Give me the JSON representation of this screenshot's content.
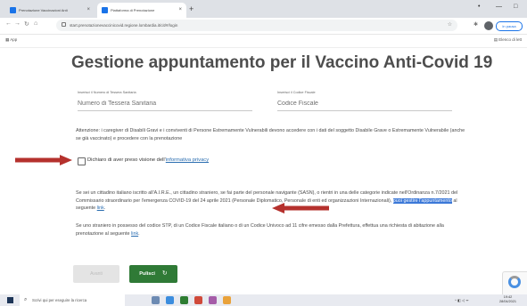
{
  "browser": {
    "tabs": [
      {
        "label": "Prenotazione Vaccinazioni Anti",
        "active": false
      },
      {
        "label": "Piattaforma di Prenotazione",
        "active": true
      }
    ],
    "new_tab": "+",
    "window_controls": [
      "•",
      "—",
      "□"
    ],
    "url": "start.prenotazionevaccinicovid.regione.lombardia.it/cit/#/login",
    "apps_label": "App",
    "other_bookmarks": "Elenco di lett",
    "profile_label": "In pausa"
  },
  "page": {
    "title": "Gestione appuntamento per il Vaccino Anti-Covid 19",
    "tessera": {
      "label": "Inserisci il Numero di Tessera Sanitaria",
      "placeholder": "Numero di Tessera Sanitaria"
    },
    "codice_fiscale": {
      "label": "Inserisci il Codice Fiscale",
      "placeholder": "Codice Fiscale"
    },
    "caregiver_notice": "Attenzione: i caregiver di Disabili Gravi e i conviventi di Persone Estremamente Vulnerabili devono accedere con i dati del soggetto Disabile Grave o Estremamente Vulnerabile (anche se già vaccinato) e procedere con la prenotazione",
    "privacy_checkbox": {
      "text": "Dichiaro di aver preso visione dell'",
      "link": "informativa privacy"
    },
    "aire_paragraph": {
      "text": "Se sei un cittadino italiano iscritto all'A.I.R.E., un cittadino straniero, se fai parte del personale navigante (SASN), o rientri in una delle categorie indicate nell'Ordinanza n.7/2021 del Commissario straordinario per l'emergenza COVID-19 del 24 aprile 2021 (Personale Diplomatico, Personale di enti ed organizzazioni Internazionali), ",
      "highlight": "puoi gestire l'appuntamento",
      "suffix": " al seguente ",
      "link": "link"
    },
    "stp_paragraph": {
      "text": "Se uno straniero in possesso del codice STP, di un Codice Fiscale italiano o di un Codice Univoco ad 11 cifre emesso dalla Prefettura, effettua una richiesta di abitazione alla prenotazione al seguente ",
      "link": "link"
    },
    "buttons": {
      "avanti": "Avanti",
      "pulisci": "Pulisci"
    }
  },
  "taskbar": {
    "search_placeholder": "Scrivi qui per eseguire la ricerca",
    "time": "19:42",
    "date": "28/04/2021"
  },
  "colors": {
    "arrow": "#b5312d",
    "pulisci_button": "#2f7a36",
    "link": "#2a6db0",
    "highlight": "#3b78d8"
  }
}
